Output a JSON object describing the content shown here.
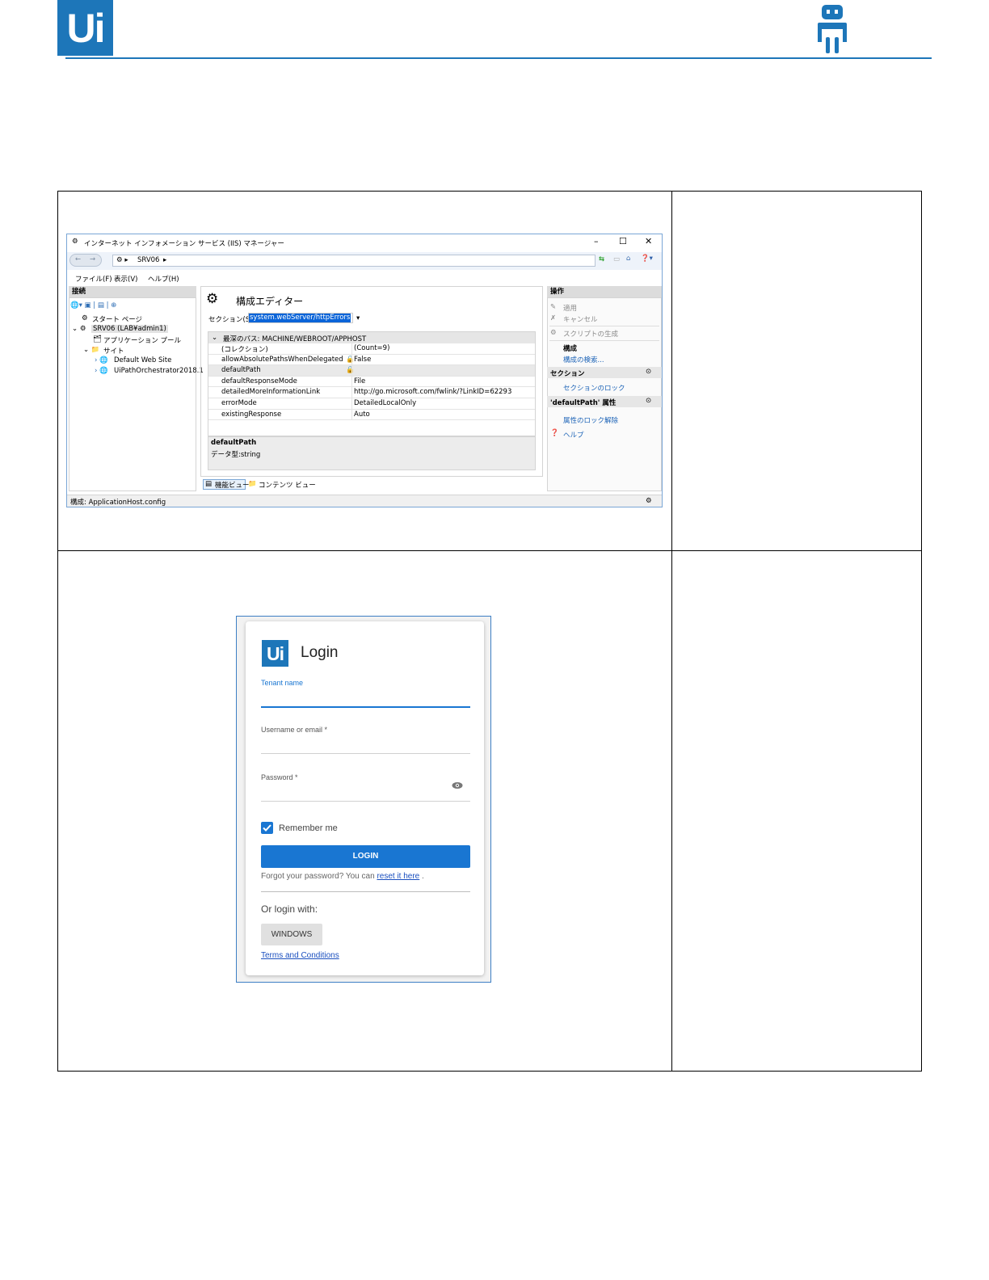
{
  "header": {
    "logo_text": "Ui",
    "accent": "#1d76b9",
    "robot_icon": "robot-icon"
  },
  "iis": {
    "title": "インターネット インフォメーション サービス (IIS) マネージャー",
    "address": "SRV06",
    "menu": [
      "ファイル(F)",
      "表示(V)",
      "ヘルプ(H)"
    ],
    "connections_header": "接続",
    "tree": [
      "スタート ページ",
      "SRV06 (LAB¥admin1)",
      "アプリケーション プール",
      "サイト",
      "Default Web Site",
      "UiPathOrchestrator2018.1"
    ],
    "editor_title": "構成エディター",
    "section_label": "セクション(S):",
    "section_value": "system.webServer/httpErrors",
    "deepest_path": "最深のパス: MACHINE/WEBROOT/APPHOST",
    "rows": [
      {
        "key": "(コレクション)",
        "value": "(Count=9)"
      },
      {
        "key": "allowAbsolutePathsWhenDelegated",
        "value": "False"
      },
      {
        "key": "defaultPath",
        "value": ""
      },
      {
        "key": "defaultResponseMode",
        "value": "File"
      },
      {
        "key": "detailedMoreInformationLink",
        "value": "http://go.microsoft.com/fwlink/?LinkID=62293"
      },
      {
        "key": "errorMode",
        "value": "DetailedLocalOnly"
      },
      {
        "key": "existingResponse",
        "value": "Auto"
      }
    ],
    "desc_title": "defaultPath",
    "desc_type": "データ型:string",
    "view_tabs": [
      "機能ビュー",
      "コンテンツ ビュー"
    ],
    "actions_header": "操作",
    "actions": {
      "apply": "適用",
      "cancel": "キャンセル",
      "script": "スクリプトの生成",
      "config": "構成",
      "search": "構成の検索...",
      "section_header": "セクション",
      "lock_section": "セクションのロック",
      "attr_header": "'defaultPath' 属性",
      "unlock_attr": "属性のロック解除",
      "help": "ヘルプ"
    },
    "status": "構成: ApplicationHost.config"
  },
  "login": {
    "logo_text": "Ui",
    "title": "Login",
    "tenant_label": "Tenant name",
    "username_label": "Username or email *",
    "password_label": "Password *",
    "remember": "Remember me",
    "remember_checked": true,
    "login_button": "LOGIN",
    "forgot_prefix": "Forgot your password? You can",
    "forgot_link": "reset it here",
    "forgot_suffix": ".",
    "or_login": "Or login with:",
    "windows_button": "WINDOWS",
    "terms": "Terms and Conditions"
  }
}
